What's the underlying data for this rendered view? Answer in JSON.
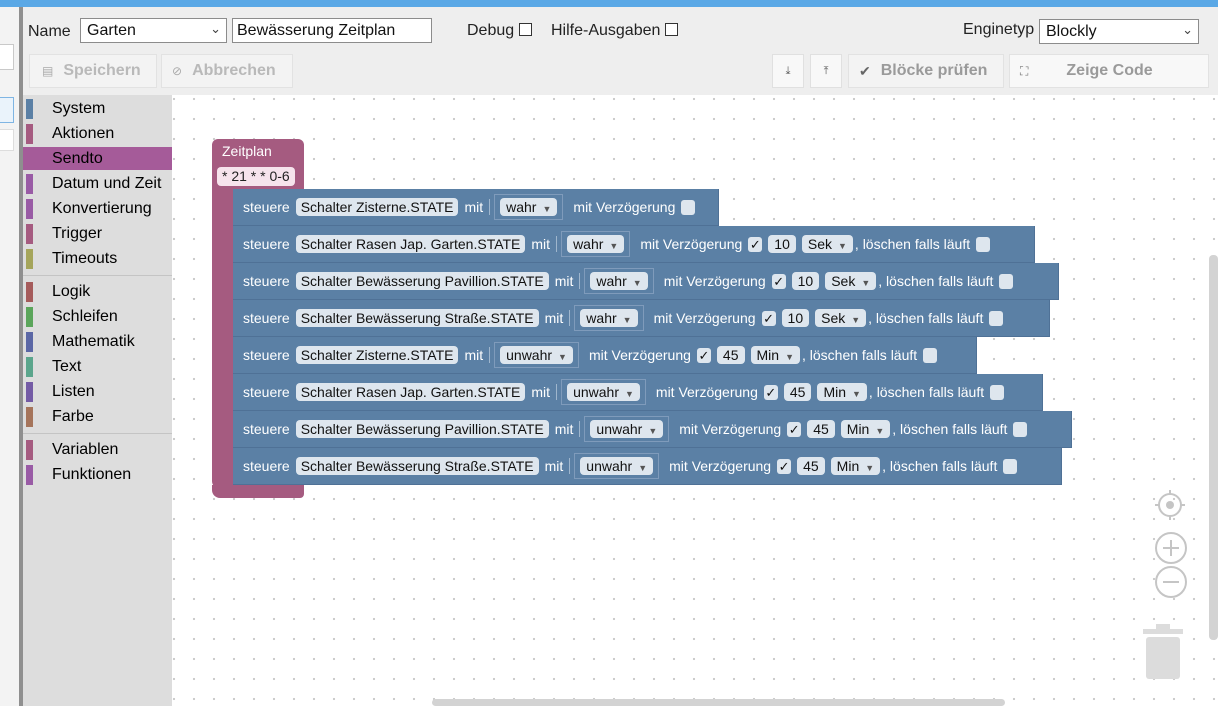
{
  "header": {
    "name_label": "Name",
    "folder_value": "Garten",
    "script_name": "Bewässerung Zeitplan",
    "debug_label": "Debug",
    "help_label": "Hilfe-Ausgaben",
    "engine_label": "Enginetyp",
    "engine_value": "Blockly"
  },
  "toolbar": {
    "save_label": "Speichern",
    "cancel_label": "Abbrechen",
    "check_label": "Blöcke prüfen",
    "code_label": "Zeige Code"
  },
  "toolbox": {
    "items": [
      {
        "label": "System",
        "color": "#5b80a5"
      },
      {
        "label": "Aktionen",
        "color": "#a55b80"
      },
      {
        "label": "Sendto",
        "color": "#a55b99"
      },
      {
        "label": "Datum und Zeit",
        "color": "#995ba5"
      },
      {
        "label": "Konvertierung",
        "color": "#995ba5"
      },
      {
        "label": "Trigger",
        "color": "#a55b80"
      },
      {
        "label": "Timeouts",
        "color": "#a5a55b"
      },
      {
        "label": "Logik",
        "color": "#a55b5b"
      },
      {
        "label": "Schleifen",
        "color": "#5ba55b"
      },
      {
        "label": "Mathematik",
        "color": "#5b67a5"
      },
      {
        "label": "Text",
        "color": "#5ba58c"
      },
      {
        "label": "Listen",
        "color": "#745ba5"
      },
      {
        "label": "Farbe",
        "color": "#a5745b"
      },
      {
        "label": "Variablen",
        "color": "#a55b80"
      },
      {
        "label": "Funktionen",
        "color": "#995ba5"
      }
    ]
  },
  "workspace": {
    "schedule_title": "Zeitplan",
    "cron": "* 21 * * 0-6",
    "rows": [
      {
        "verb": "steuere",
        "target": "Schalter Zisterne.STATE",
        "with": "mit",
        "value": "wahr",
        "delay_label": "mit Verzögerung",
        "delay_checked": false
      },
      {
        "verb": "steuere",
        "target": "Schalter Rasen Jap. Garten.STATE",
        "with": "mit",
        "value": "wahr",
        "delay_label": "mit Verzögerung",
        "delay_checked": true,
        "check": "✓",
        "amount": "10",
        "unit": "Sek",
        "clear_label": ", löschen falls läuft"
      },
      {
        "verb": "steuere",
        "target": "Schalter Bewässerung Pavillion.STATE",
        "with": "mit",
        "value": "wahr",
        "delay_label": "mit Verzögerung",
        "delay_checked": true,
        "check": "✓",
        "amount": "10",
        "unit": "Sek",
        "clear_label": ", löschen falls läuft"
      },
      {
        "verb": "steuere",
        "target": "Schalter Bewässerung Straße.STATE",
        "with": "mit",
        "value": "wahr",
        "delay_label": "mit Verzögerung",
        "delay_checked": true,
        "check": "✓",
        "amount": "10",
        "unit": "Sek",
        "clear_label": ", löschen falls läuft"
      },
      {
        "verb": "steuere",
        "target": "Schalter Zisterne.STATE",
        "with": "mit",
        "value": "unwahr",
        "delay_label": "mit Verzögerung",
        "delay_checked": true,
        "check": "✓",
        "amount": "45",
        "unit": "Min",
        "clear_label": ", löschen falls läuft"
      },
      {
        "verb": "steuere",
        "target": "Schalter Rasen Jap. Garten.STATE",
        "with": "mit",
        "value": "unwahr",
        "delay_label": "mit Verzögerung",
        "delay_checked": true,
        "check": "✓",
        "amount": "45",
        "unit": "Min",
        "clear_label": ", löschen falls läuft"
      },
      {
        "verb": "steuere",
        "target": "Schalter Bewässerung Pavillion.STATE",
        "with": "mit",
        "value": "unwahr",
        "delay_label": "mit Verzögerung",
        "delay_checked": true,
        "check": "✓",
        "amount": "45",
        "unit": "Min",
        "clear_label": ", löschen falls läuft"
      },
      {
        "verb": "steuere",
        "target": "Schalter Bewässerung Straße.STATE",
        "with": "mit",
        "value": "unwahr",
        "delay_label": "mit Verzögerung",
        "delay_checked": true,
        "check": "✓",
        "amount": "45",
        "unit": "Min",
        "clear_label": ", löschen falls läuft"
      }
    ]
  }
}
